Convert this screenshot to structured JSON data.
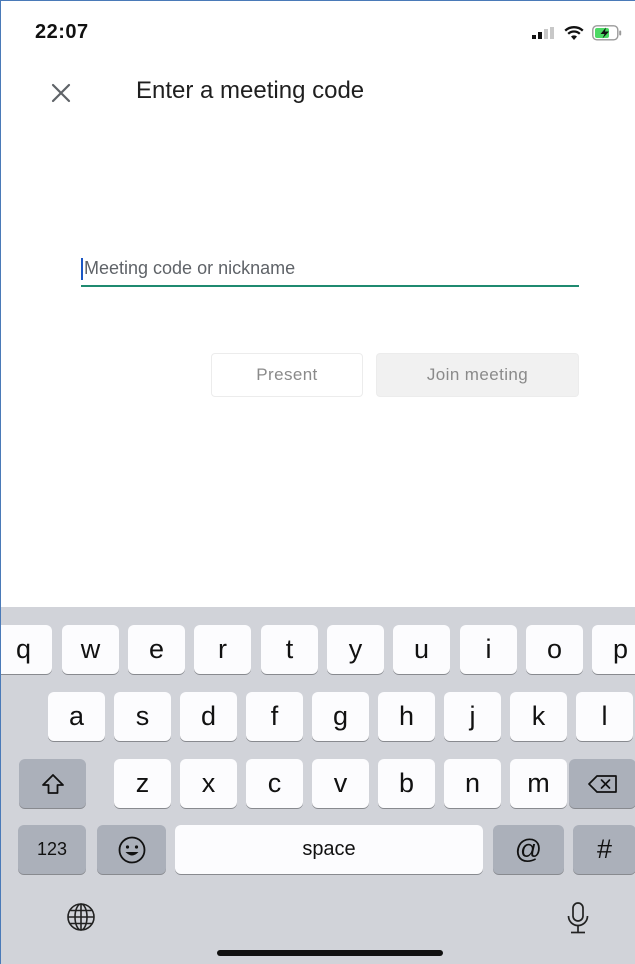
{
  "status_bar": {
    "time": "22:07",
    "icons": [
      "signal-icon",
      "wifi-icon",
      "battery-charging-icon"
    ]
  },
  "header": {
    "title": "Enter a meeting code",
    "close_icon": "close-icon"
  },
  "input": {
    "placeholder": "Meeting code or nickname",
    "value": ""
  },
  "buttons": {
    "present": "Present",
    "join": "Join meeting"
  },
  "keyboard": {
    "row1": [
      "q",
      "w",
      "e",
      "r",
      "t",
      "y",
      "u",
      "i",
      "o",
      "p"
    ],
    "row2": [
      "a",
      "s",
      "d",
      "f",
      "g",
      "h",
      "j",
      "k",
      "l"
    ],
    "row3": [
      "z",
      "x",
      "c",
      "v",
      "b",
      "n",
      "m"
    ],
    "numbers": "123",
    "space": "space",
    "at": "@",
    "hash": "#",
    "icons": [
      "shift-icon",
      "backspace-icon",
      "emoji-icon",
      "globe-icon",
      "microphone-icon"
    ]
  },
  "colors": {
    "accent_underline": "#1f8a70",
    "caret": "#1a56c4",
    "keyboard_bg": "#d1d3d9",
    "key_dark": "#abb0ba"
  }
}
